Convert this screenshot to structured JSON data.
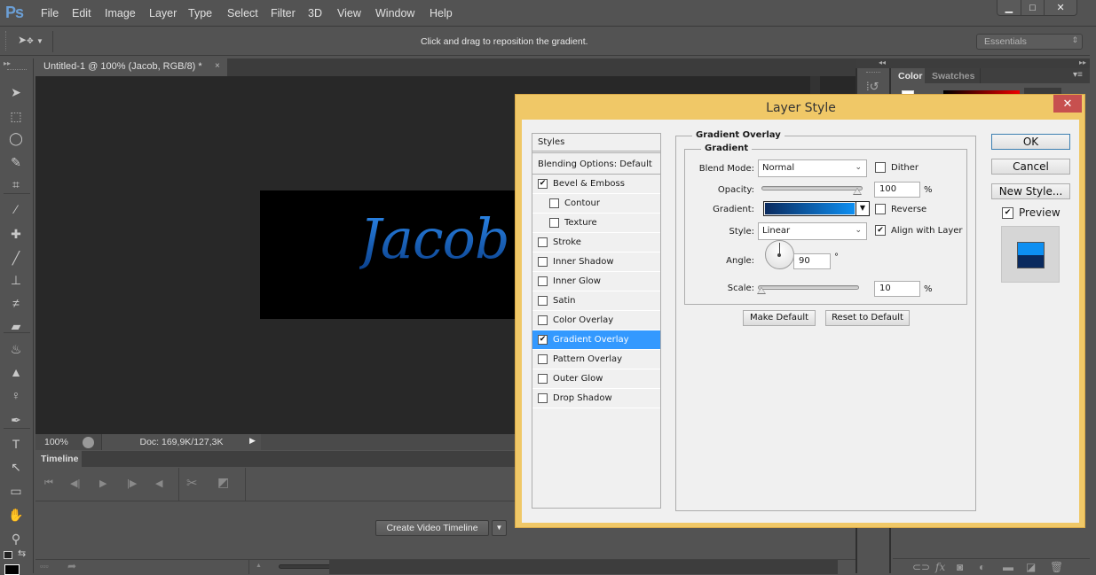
{
  "app": {
    "logo": "Ps",
    "menu": [
      "File",
      "Edit",
      "Image",
      "Layer",
      "Type",
      "Select",
      "Filter",
      "3D",
      "View",
      "Window",
      "Help"
    ],
    "window_controls": {
      "minimize": "▁",
      "maximize": "□",
      "close": "✕"
    }
  },
  "options_bar": {
    "tool_icon": "move-tool-icon",
    "hint": "Click and drag to reposition the gradient.",
    "workspace": "Essentials"
  },
  "toolbox": {
    "tools": [
      {
        "name": "move-tool",
        "glyph": "➤"
      },
      {
        "name": "marquee-tool",
        "glyph": "⬚"
      },
      {
        "name": "lasso-tool",
        "glyph": "◯"
      },
      {
        "name": "quick-selection-tool",
        "glyph": "✎"
      },
      {
        "name": "crop-tool",
        "glyph": "⌗"
      },
      {
        "name": "eyedropper-tool",
        "glyph": "⁄"
      },
      {
        "name": "healing-brush-tool",
        "glyph": "✚"
      },
      {
        "name": "brush-tool",
        "glyph": "╱"
      },
      {
        "name": "clone-stamp-tool",
        "glyph": "⊥"
      },
      {
        "name": "history-brush-tool",
        "glyph": "≠"
      },
      {
        "name": "eraser-tool",
        "glyph": "▰"
      },
      {
        "name": "paint-bucket-tool",
        "glyph": "♨"
      },
      {
        "name": "blur-tool",
        "glyph": "▲"
      },
      {
        "name": "dodge-tool",
        "glyph": "♀"
      },
      {
        "name": "pen-tool",
        "glyph": "✒"
      },
      {
        "name": "type-tool",
        "glyph": "T"
      },
      {
        "name": "path-selection-tool",
        "glyph": "↖"
      },
      {
        "name": "rectangle-tool",
        "glyph": "▭"
      },
      {
        "name": "hand-tool",
        "glyph": "✋"
      },
      {
        "name": "zoom-tool",
        "glyph": "⚲"
      }
    ],
    "swap_colors": "⇆",
    "default_colors": "◧",
    "foreground_color": "#000000"
  },
  "document": {
    "tab_title": "Untitled-1 @ 100% (Jacob, RGB/8) *",
    "tab_close": "×",
    "canvas_text": "Jacob",
    "zoom": "100%",
    "doc_size": "Doc: 169,9K/127,3K"
  },
  "timeline": {
    "tab": "Timeline",
    "create_button": "Create Video Timeline",
    "controls": [
      "⏮",
      "◀|",
      "▶",
      "|▶",
      "◀"
    ]
  },
  "panels": {
    "tabs": [
      "Color",
      "Swatches"
    ],
    "active_tab": "Color"
  },
  "dialog": {
    "title": "Layer Style",
    "close": "✕",
    "styles_list": [
      {
        "label": "Styles",
        "type": "header"
      },
      {
        "label": "Blending Options: Default",
        "type": "header"
      },
      {
        "label": "Bevel & Emboss",
        "checked": true,
        "indent": false
      },
      {
        "label": "Contour",
        "checked": false,
        "indent": true
      },
      {
        "label": "Texture",
        "checked": false,
        "indent": true
      },
      {
        "label": "Stroke",
        "checked": false,
        "indent": false
      },
      {
        "label": "Inner Shadow",
        "checked": false,
        "indent": false
      },
      {
        "label": "Inner Glow",
        "checked": false,
        "indent": false
      },
      {
        "label": "Satin",
        "checked": false,
        "indent": false
      },
      {
        "label": "Color Overlay",
        "checked": false,
        "indent": false
      },
      {
        "label": "Gradient Overlay",
        "checked": true,
        "indent": false,
        "selected": true
      },
      {
        "label": "Pattern Overlay",
        "checked": false,
        "indent": false
      },
      {
        "label": "Outer Glow",
        "checked": false,
        "indent": false
      },
      {
        "label": "Drop Shadow",
        "checked": false,
        "indent": false
      }
    ],
    "section_title": "Gradient Overlay",
    "subsection_title": "Gradient",
    "fields": {
      "blend_mode_label": "Blend Mode:",
      "blend_mode": "Normal",
      "dither_label": "Dither",
      "dither": false,
      "opacity_label": "Opacity:",
      "opacity": "100",
      "opacity_pct": 1.0,
      "percent": "%",
      "gradient_label": "Gradient:",
      "gradient_colors": [
        "#0a2a5e",
        "#0d8ff2"
      ],
      "reverse_label": "Reverse",
      "reverse": false,
      "style_label": "Style:",
      "style": "Linear",
      "align_label": "Align with Layer",
      "align": true,
      "angle_label": "Angle:",
      "angle": "90",
      "degree": "°",
      "scale_label": "Scale:",
      "scale": "10",
      "scale_pct": 0.1
    },
    "buttons": {
      "make_default": "Make Default",
      "reset_default": "Reset to Default",
      "ok": "OK",
      "cancel": "Cancel",
      "new_style": "New Style..."
    },
    "preview_label": "Preview",
    "preview": true
  }
}
